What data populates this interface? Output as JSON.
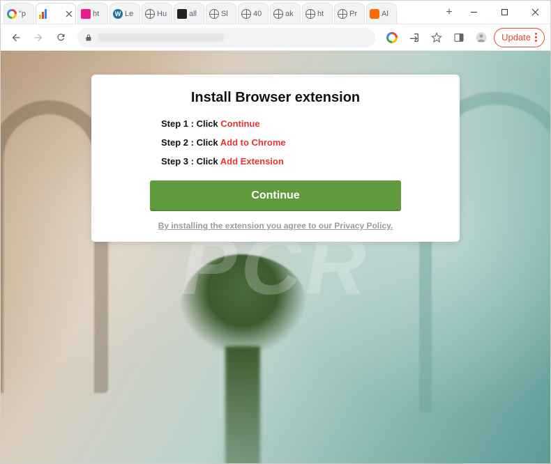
{
  "tabs": [
    {
      "title": "\"p",
      "icon": "google",
      "active": false
    },
    {
      "title": "",
      "icon": "bars",
      "active": true
    },
    {
      "title": "ht",
      "icon": "pink",
      "active": false
    },
    {
      "title": "Le",
      "icon": "wp",
      "active": false
    },
    {
      "title": "Hu",
      "icon": "globe",
      "active": false
    },
    {
      "title": "all",
      "icon": "dark",
      "active": false
    },
    {
      "title": "Sl",
      "icon": "globe",
      "active": false
    },
    {
      "title": "40",
      "icon": "globe",
      "active": false
    },
    {
      "title": "ak",
      "icon": "globe",
      "active": false
    },
    {
      "title": "ht",
      "icon": "globe",
      "active": false
    },
    {
      "title": "Pr",
      "icon": "globe",
      "active": false
    },
    {
      "title": "Al",
      "icon": "orange",
      "active": false
    }
  ],
  "newtab_glyph": "+",
  "window_controls": {
    "min": "minimize",
    "max": "maximize",
    "close": "close"
  },
  "toolbar": {
    "update_label": "Update",
    "google_icon": "google"
  },
  "modal": {
    "title": "Install Browser extension",
    "steps": [
      {
        "prefix": "Step 1 : Click ",
        "highlight": "Continue"
      },
      {
        "prefix": "Step 2 : Click ",
        "highlight": "Add to Chrome"
      },
      {
        "prefix": "Step 3 : Click ",
        "highlight": "Add Extension"
      }
    ],
    "continue_label": "Continue",
    "policy_text": "By installing the extension you agree to our Privacy Policy."
  },
  "watermark": "PCR"
}
